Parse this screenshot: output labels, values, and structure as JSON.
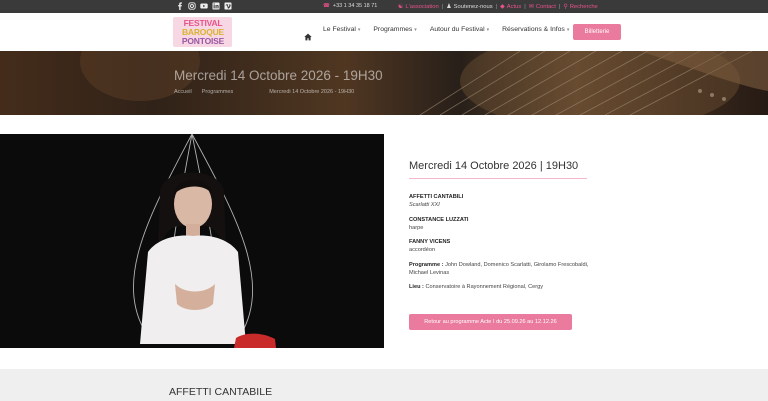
{
  "topbar": {
    "social": [
      {
        "icon": "facebook-icon"
      },
      {
        "icon": "instagram-icon"
      },
      {
        "icon": "youtube-icon"
      },
      {
        "icon": "linkedin-icon"
      },
      {
        "icon": "vimeo-icon"
      }
    ],
    "phone": "+33 1 34 35 18 71",
    "links": [
      {
        "icon": "handshake-icon",
        "label": "L'association",
        "accent": true
      },
      {
        "icon": "user-icon",
        "label": "Soutenez-nous",
        "accent": false
      },
      {
        "icon": "bell-icon",
        "label": "Actus",
        "accent": true
      },
      {
        "icon": "envelope-icon",
        "label": "Contact",
        "accent": true
      },
      {
        "icon": "search-icon",
        "label": "Recherche",
        "accent": true
      }
    ]
  },
  "header": {
    "logo": {
      "line1": "FESTIVAL",
      "line2": "BAROQUE",
      "line3": "PONTOISE"
    },
    "nav": [
      {
        "label": "Le Festival"
      },
      {
        "label": "Programmes"
      },
      {
        "label": "Autour du Festival"
      },
      {
        "label": "Réservations & Infos"
      }
    ],
    "ticket_label": "Billetterie"
  },
  "hero": {
    "title": "Mercredi 14 Octobre 2026 - 19H30",
    "breadcrumb": [
      "Accueil",
      "Programmes",
      "Mercredi 14 Octobre 2026 - 19H30"
    ]
  },
  "event": {
    "title": "Mercredi 14 Octobre 2026 | 19H30",
    "ensemble": "AFFETTI CANTABILI",
    "ensemble_sub": "Scarlatti XXI",
    "artist1": "CONSTANCE LUZZATI",
    "artist1_role": "harpe",
    "artist2": "FANNY VICENS",
    "artist2_role": "accordéon",
    "programme_label": "Programme :",
    "programme_text": "John Dowland, Domenico Scarlatti, Girolamo Frescobaldi, Michael Levinas",
    "lieu_label": "Lieu :",
    "lieu_text": "Conservatoire à Rayonnement Régional, Cergy",
    "back_button": "Retour au programme Acte I du 25.09.26 au 12.12.26"
  },
  "section": {
    "title": "AFFETTI CANTABILE"
  },
  "colors": {
    "accent": "#ea7a9e",
    "topbar": "#3a3a3a",
    "band": "#efefef"
  }
}
